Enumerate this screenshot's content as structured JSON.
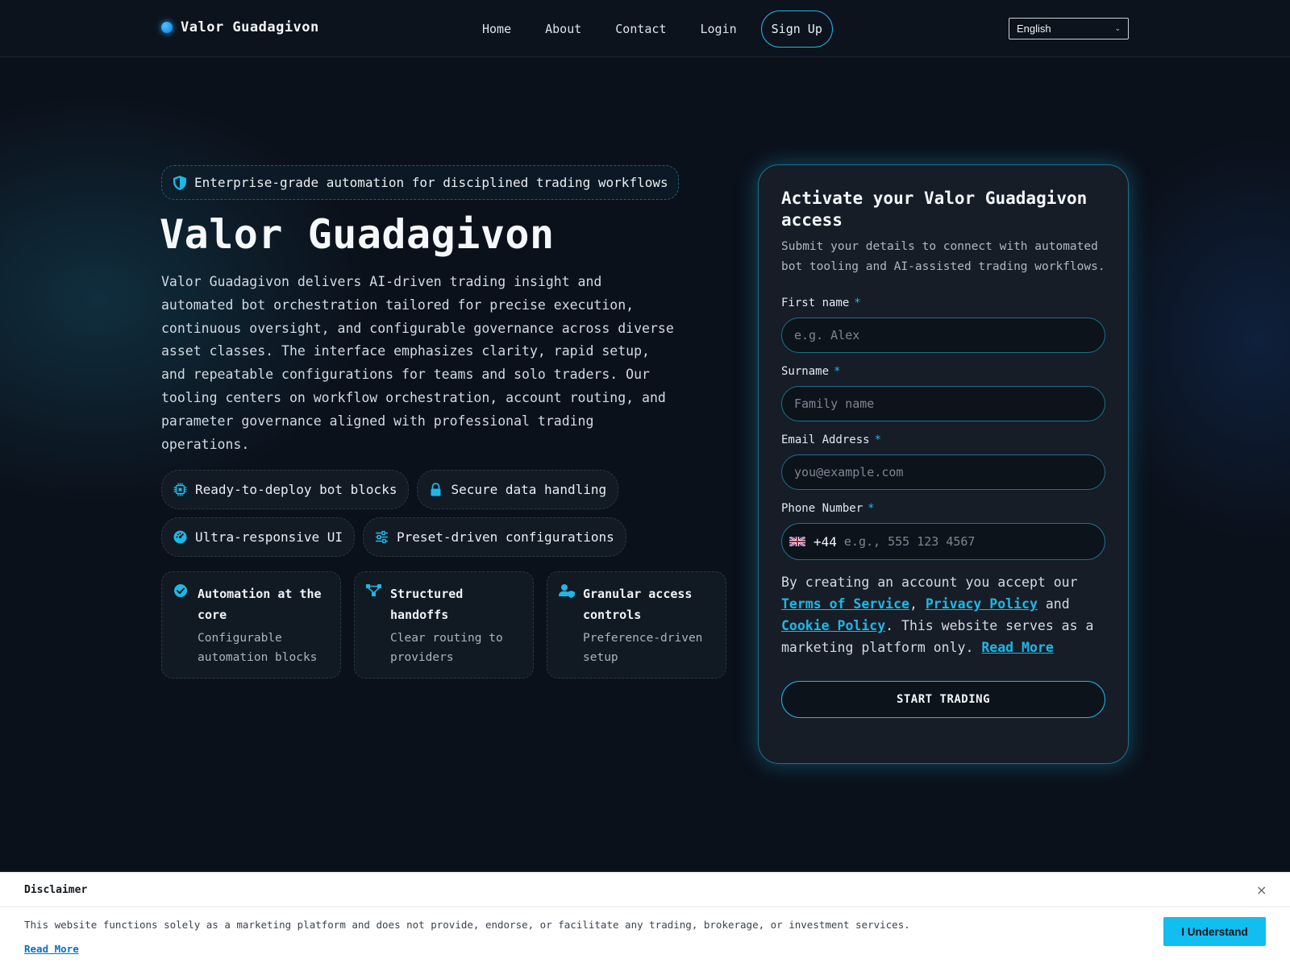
{
  "nav": {
    "brand": "Valor Guadagivon",
    "links": [
      {
        "label": "Home"
      },
      {
        "label": "About"
      },
      {
        "label": "Contact"
      },
      {
        "label": "Login"
      },
      {
        "label": "Sign Up"
      }
    ],
    "language": "English"
  },
  "hero": {
    "badge": "Enterprise-grade automation for disciplined trading workflows",
    "title": "Valor Guadagivon",
    "description": "Valor Guadagivon delivers AI-driven trading insight and automated bot orchestration tailored for precise execution, continuous oversight, and configurable governance across diverse asset classes. The interface emphasizes clarity, rapid setup, and repeatable configurations for teams and solo traders. Our tooling centers on workflow orchestration, account routing, and parameter governance aligned with professional trading operations.",
    "chips": [
      {
        "label": "Ready-to-deploy bot blocks",
        "icon": "chip-icon"
      },
      {
        "label": "Secure data handling",
        "icon": "lock-icon"
      },
      {
        "label": "Ultra-responsive UI",
        "icon": "gauge-icon"
      },
      {
        "label": "Preset-driven configurations",
        "icon": "sliders-icon"
      }
    ],
    "cards": [
      {
        "title": "Automation at the core",
        "sub": "Configurable automation blocks",
        "icon": "check-circle-icon"
      },
      {
        "title": "Structured handoffs",
        "sub": "Clear routing to providers",
        "icon": "network-icon"
      },
      {
        "title": "Granular access controls",
        "sub": "Preference-driven setup",
        "icon": "user-shield-icon"
      }
    ]
  },
  "form": {
    "title": "Activate your Valor Guadagivon access",
    "subtitle": "Submit your details to connect with automated bot tooling and AI-assisted trading workflows.",
    "first_name": {
      "label": "First name",
      "placeholder": "e.g. Alex"
    },
    "surname": {
      "label": "Surname",
      "placeholder": "Family name"
    },
    "email": {
      "label": "Email Address",
      "placeholder": "you@example.com"
    },
    "phone": {
      "label": "Phone Number",
      "code": "+44",
      "placeholder": "e.g., 555 123 4567"
    },
    "required_mark": "*",
    "terms": {
      "prefix": "By creating an account you accept our ",
      "tos": "Terms of Service",
      "comma": ", ",
      "privacy": "Privacy Policy",
      "and": " and ",
      "cookie": "Cookie Policy",
      "suffix": ". This website serves as a marketing platform only. ",
      "read_more": "Read More"
    },
    "cta": "START TRADING"
  },
  "disclaimer": {
    "title": "Disclaimer",
    "close": "×",
    "text": "This website functions solely as a marketing platform and does not provide, endorse, or facilitate any trading, brokerage, or investment services.",
    "read_more": "Read More",
    "button": "I Understand"
  },
  "colors": {
    "accent": "#1fb7e6",
    "background": "#0b111b",
    "card": "#161d27"
  }
}
